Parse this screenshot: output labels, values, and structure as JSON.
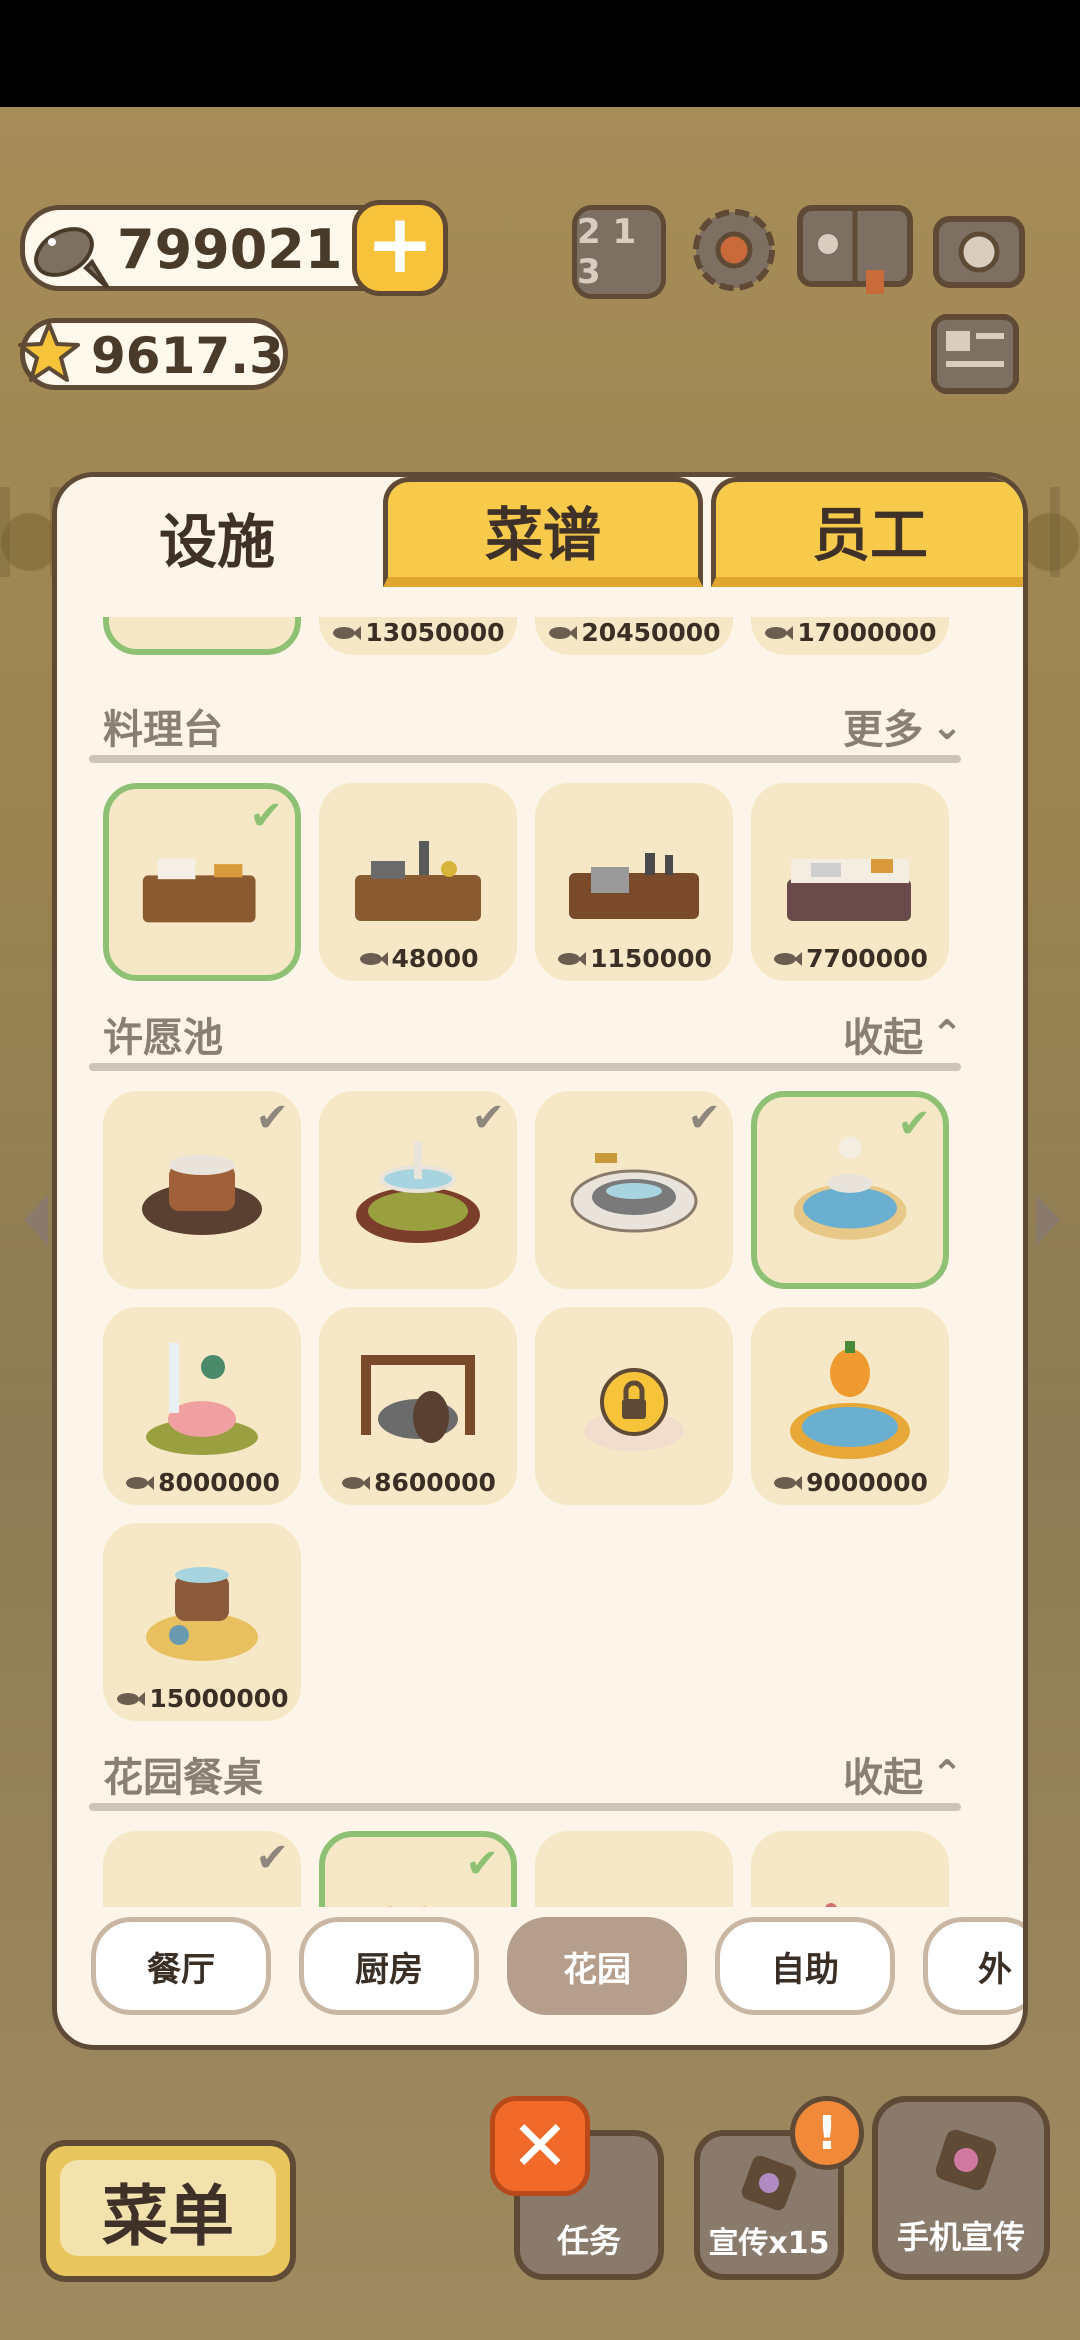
{
  "currency": {
    "fish": "799021",
    "stars": "9617.3"
  },
  "tabs": {
    "facilities": "设施",
    "recipes": "菜谱",
    "staff": "员工"
  },
  "top_row_prices": [
    "13050000",
    "20450000",
    "17000000"
  ],
  "sections": [
    {
      "title": "料理台",
      "toggle": "更多",
      "toggle_icon": "chevron-down-icon",
      "items": [
        {
          "owned": true,
          "selected": true,
          "price": ""
        },
        {
          "owned": false,
          "selected": false,
          "price": "48000"
        },
        {
          "owned": false,
          "selected": false,
          "price": "1150000"
        },
        {
          "owned": false,
          "selected": false,
          "price": "7700000"
        }
      ]
    },
    {
      "title": "许愿池",
      "toggle": "收起",
      "toggle_icon": "chevron-up-icon",
      "items": [
        {
          "owned": true,
          "selected": false,
          "price": ""
        },
        {
          "owned": true,
          "selected": false,
          "price": ""
        },
        {
          "owned": true,
          "selected": false,
          "price": ""
        },
        {
          "owned": true,
          "selected": true,
          "price": ""
        },
        {
          "owned": false,
          "selected": false,
          "price": "8000000"
        },
        {
          "owned": false,
          "selected": false,
          "price": "8600000"
        },
        {
          "owned": false,
          "selected": false,
          "locked": true,
          "price": ""
        },
        {
          "owned": false,
          "selected": false,
          "price": "9000000"
        },
        {
          "owned": false,
          "selected": false,
          "price": "15000000"
        }
      ]
    },
    {
      "title": "花园餐桌",
      "toggle": "收起",
      "toggle_icon": "chevron-up-icon",
      "items": [
        {
          "owned": true,
          "selected": false,
          "price": ""
        },
        {
          "owned": true,
          "selected": true,
          "price": ""
        }
      ]
    }
  ],
  "areas": [
    "餐厅",
    "厨房",
    "花园",
    "自助",
    "外"
  ],
  "active_area": "花园",
  "bottom": {
    "menu": "菜单",
    "tasks": "任务",
    "promo": "宣传x15",
    "phone_promo": "手机宣传"
  },
  "colors": {
    "accent_yellow": "#f8ca4c",
    "selected_green": "#8fc175",
    "panel_bg": "#fdf5e9",
    "item_bg": "#f6e8c6",
    "close_orange": "#f16a2a"
  }
}
